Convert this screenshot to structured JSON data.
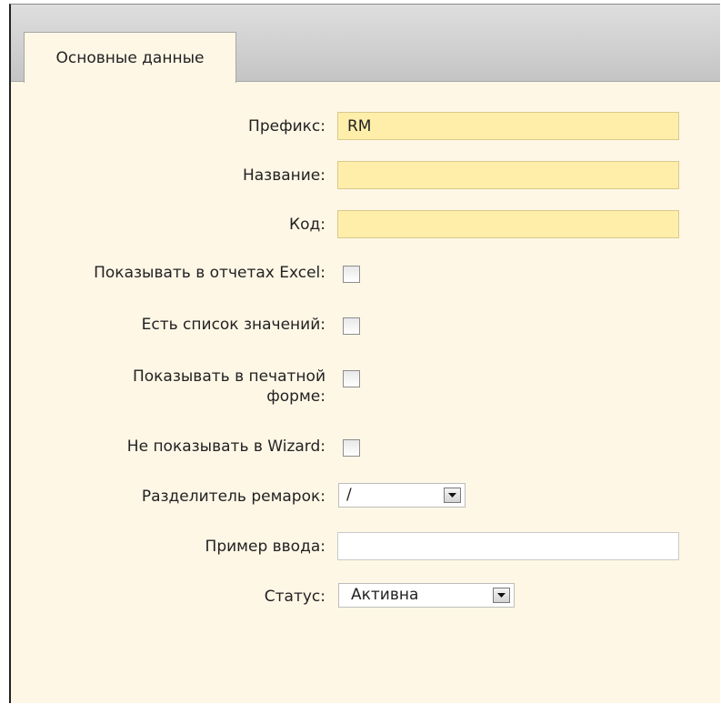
{
  "tabs": [
    {
      "label": "Основные данные",
      "active": true
    }
  ],
  "form": {
    "prefix": {
      "label": "Префикс:",
      "value": "RM"
    },
    "name": {
      "label": "Название:",
      "value": ""
    },
    "code": {
      "label": "Код:",
      "value": ""
    },
    "show_excel": {
      "label": "Показывать в отчетах Excel:",
      "checked": false
    },
    "has_values_list": {
      "label": "Есть список значений:",
      "checked": false
    },
    "show_print_line1": "Показывать в печатной",
    "show_print_line2": "форме:",
    "show_print_checked": false,
    "hide_wizard": {
      "label": "Не показывать в Wizard:",
      "checked": false
    },
    "remark_separator": {
      "label": "Разделитель ремарок:",
      "value": "/"
    },
    "input_example": {
      "label": "Пример ввода:",
      "value": ""
    },
    "status": {
      "label": "Статус:",
      "value": "Активна"
    }
  },
  "icons": {
    "dropdown": "chevron-down-icon"
  },
  "colors": {
    "panel_bg": "#fff7e6",
    "required_field_bg": "#ffeeaa",
    "tabbar_bg": "#cfcfcf"
  }
}
